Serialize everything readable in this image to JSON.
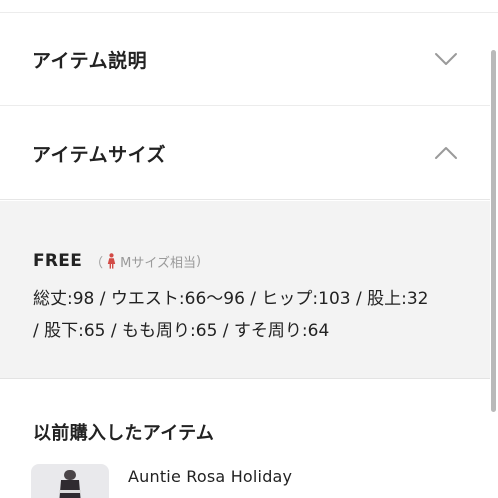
{
  "item_description": {
    "title": "アイテム説明",
    "toggle_icon": "chevron-down-icon"
  },
  "item_size": {
    "title": "アイテムサイズ",
    "toggle_icon": "chevron-up-icon",
    "size_label": "FREE",
    "size_note": {
      "open_paren": "（",
      "icon": "person-icon",
      "text": "Mサイズ相当",
      "close_paren": ")"
    },
    "measurements": "総丈:98 / ウエスト:66～96 / ヒップ:103 / 股上:32 / 股下:65 / もも周り:65 / すそ周り:64"
  },
  "previously_purchased": {
    "title": "以前購入したアイテム",
    "items": [
      {
        "name": "Auntie Rosa Holiday"
      }
    ]
  },
  "colors": {
    "accent_icon": "#d24b46",
    "panel_bg": "#f3f3f3",
    "chevron": "#9a9a9a"
  }
}
